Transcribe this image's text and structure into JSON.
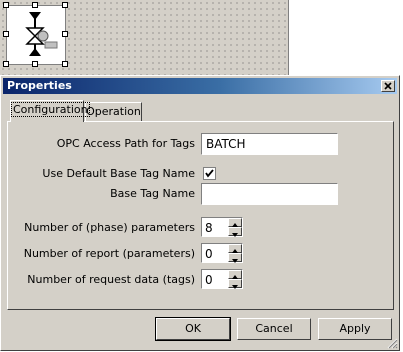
{
  "window": {
    "title": "Properties"
  },
  "tabs": [
    {
      "label": "Configuration",
      "active": true
    },
    {
      "label": "Operation",
      "active": false
    }
  ],
  "form": {
    "opc_access_path_label": "OPC Access Path for Tags",
    "opc_access_path_value": "BATCH",
    "use_default_base_tag_label": "Use Default Base Tag Name",
    "use_default_base_tag_checked": true,
    "base_tag_name_label": "Base Tag Name",
    "base_tag_name_value": "",
    "phase_params_label": "Number of (phase) parameters",
    "phase_params_value": "8",
    "report_params_label": "Number of report (parameters)",
    "report_params_value": "0",
    "request_data_label": "Number of request data (tags)",
    "request_data_value": "0"
  },
  "buttons": {
    "ok": "OK",
    "cancel": "Cancel",
    "apply": "Apply"
  },
  "icons": {
    "canvas_object": "valve-icon",
    "close": "close-icon",
    "checkbox": "checkmark-icon",
    "spin_up": "spin-up-icon",
    "spin_down": "spin-down-icon",
    "grip": "resize-grip-icon"
  }
}
